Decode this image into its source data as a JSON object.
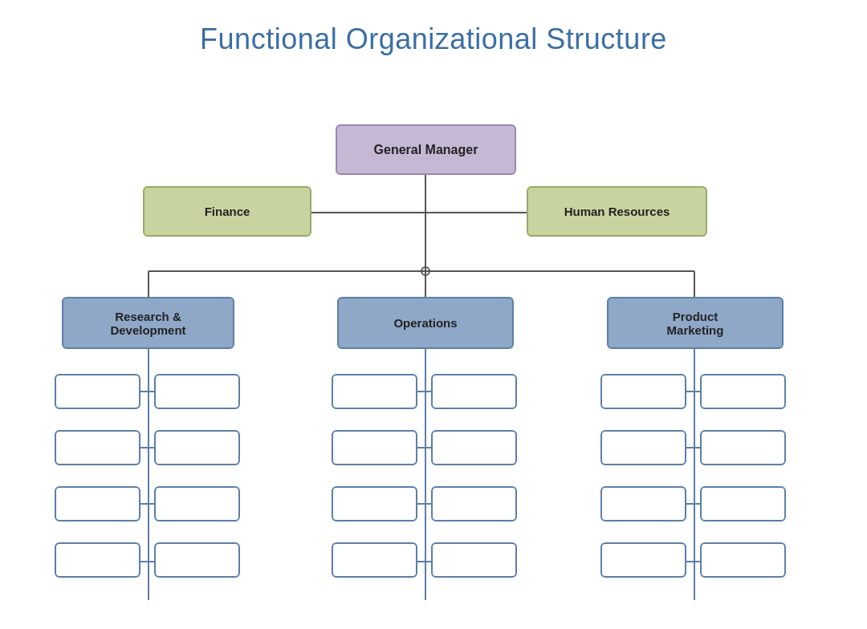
{
  "title": "Functional Organizational Structure",
  "nodes": {
    "general_manager": {
      "label": "General Manager"
    },
    "finance": {
      "label": "Finance"
    },
    "human_resources": {
      "label": "Human Resources"
    },
    "research_development": {
      "label": "Research &\nDevelopment"
    },
    "operations": {
      "label": "Operations"
    },
    "product_marketing": {
      "label": "Product\nMarketing"
    }
  }
}
